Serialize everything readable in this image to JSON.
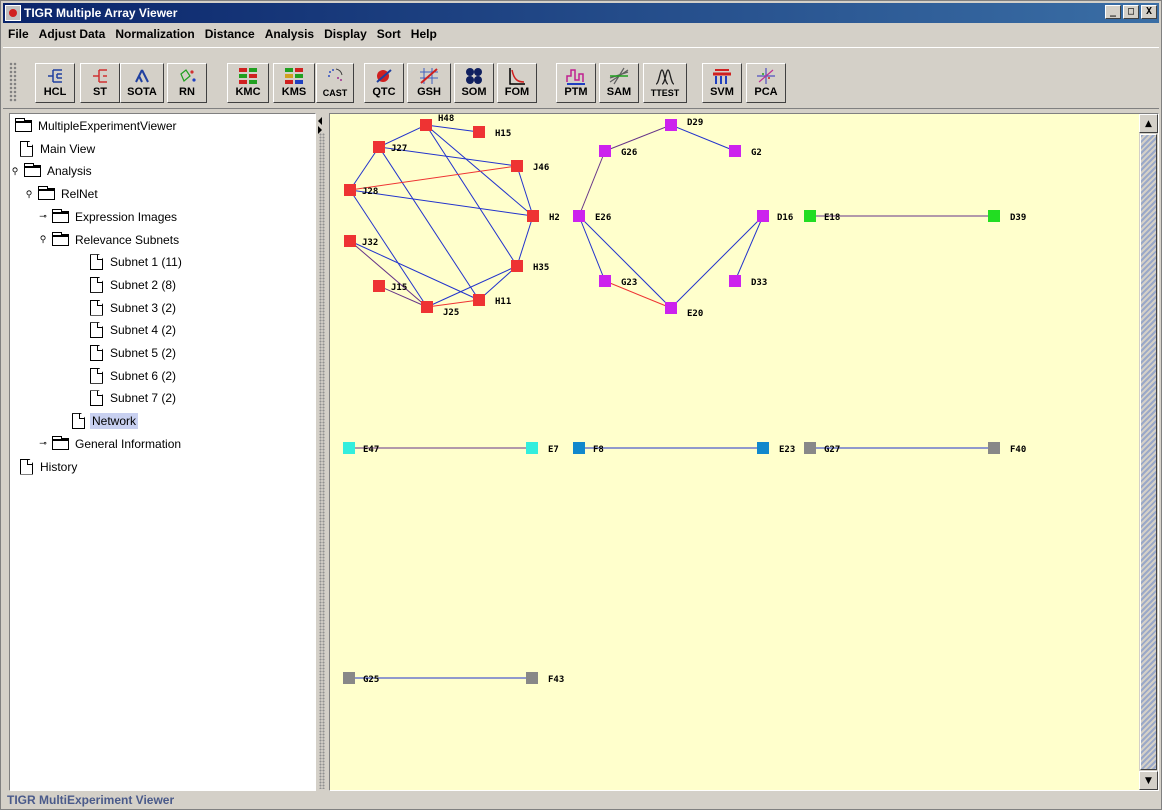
{
  "window": {
    "title": "TIGR Multiple Array Viewer",
    "min_label": "_",
    "max_label": "□",
    "close_label": "X"
  },
  "menu": [
    "File",
    "Adjust Data",
    "Normalization",
    "Distance",
    "Analysis",
    "Display",
    "Sort",
    "Help"
  ],
  "toolbar": [
    {
      "label": "HCL",
      "icon": "hcl-icon"
    },
    {
      "label": "ST",
      "icon": "st-icon"
    },
    {
      "label": "SOTA",
      "icon": "sota-icon"
    },
    {
      "label": "RN",
      "icon": "rn-icon"
    },
    {
      "label": "KMC",
      "icon": "kmc-icon"
    },
    {
      "label": "KMS",
      "icon": "kms-icon"
    },
    {
      "label": "CAST",
      "icon": "cast-icon"
    },
    {
      "label": "QTC",
      "icon": "qtc-icon"
    },
    {
      "label": "GSH",
      "icon": "gsh-icon"
    },
    {
      "label": "SOM",
      "icon": "som-icon"
    },
    {
      "label": "FOM",
      "icon": "fom-icon"
    },
    {
      "label": "PTM",
      "icon": "ptm-icon"
    },
    {
      "label": "SAM",
      "icon": "sam-icon"
    },
    {
      "label": "TTEST",
      "icon": "ttest-icon"
    },
    {
      "label": "SVM",
      "icon": "svm-icon"
    },
    {
      "label": "PCA",
      "icon": "pca-icon"
    }
  ],
  "tree": [
    {
      "label": "MultipleExperimentViewer",
      "icon": "folder",
      "toggle": ""
    },
    {
      "label": "Main View",
      "icon": "doc",
      "toggle": ""
    },
    {
      "label": "Analysis",
      "icon": "folder",
      "toggle": "open"
    },
    {
      "label": "RelNet",
      "icon": "folder",
      "toggle": "open"
    },
    {
      "label": "Expression Images",
      "icon": "folder",
      "toggle": "closed"
    },
    {
      "label": "Relevance Subnets",
      "icon": "folder",
      "toggle": "open"
    },
    {
      "label": "Subnet 1 (11)",
      "icon": "doc",
      "toggle": ""
    },
    {
      "label": "Subnet 2 (8)",
      "icon": "doc",
      "toggle": ""
    },
    {
      "label": "Subnet 3 (2)",
      "icon": "doc",
      "toggle": ""
    },
    {
      "label": "Subnet 4 (2)",
      "icon": "doc",
      "toggle": ""
    },
    {
      "label": "Subnet 5 (2)",
      "icon": "doc",
      "toggle": ""
    },
    {
      "label": "Subnet 6 (2)",
      "icon": "doc",
      "toggle": ""
    },
    {
      "label": "Subnet 7 (2)",
      "icon": "doc",
      "toggle": ""
    },
    {
      "label": "Network",
      "icon": "doc",
      "toggle": "",
      "selected": true
    },
    {
      "label": "General Information",
      "icon": "folder",
      "toggle": "closed"
    },
    {
      "label": "History",
      "icon": "doc",
      "toggle": ""
    }
  ],
  "network": {
    "nodes": [
      {
        "id": "H48",
        "color": "#ee3333"
      },
      {
        "id": "H15",
        "color": "#ee3333"
      },
      {
        "id": "J27",
        "color": "#ee3333"
      },
      {
        "id": "J46",
        "color": "#ee3333"
      },
      {
        "id": "J28",
        "color": "#ee3333"
      },
      {
        "id": "H2",
        "color": "#ee3333"
      },
      {
        "id": "J32",
        "color": "#ee3333"
      },
      {
        "id": "H35",
        "color": "#ee3333"
      },
      {
        "id": "J15",
        "color": "#ee3333"
      },
      {
        "id": "H11",
        "color": "#ee3333"
      },
      {
        "id": "J25",
        "color": "#ee3333"
      },
      {
        "id": "D29",
        "color": "#cc22ee"
      },
      {
        "id": "G26",
        "color": "#cc22ee"
      },
      {
        "id": "G2",
        "color": "#cc22ee"
      },
      {
        "id": "E26",
        "color": "#cc22ee"
      },
      {
        "id": "D16",
        "color": "#cc22ee"
      },
      {
        "id": "G23",
        "color": "#cc22ee"
      },
      {
        "id": "D33",
        "color": "#cc22ee"
      },
      {
        "id": "E20",
        "color": "#cc22ee"
      },
      {
        "id": "E18",
        "color": "#22dd22"
      },
      {
        "id": "D39",
        "color": "#22dd22"
      },
      {
        "id": "E47",
        "color": "#33eedd"
      },
      {
        "id": "E7",
        "color": "#33eedd"
      },
      {
        "id": "F8",
        "color": "#1188cc"
      },
      {
        "id": "E23",
        "color": "#1188cc"
      },
      {
        "id": "G27",
        "color": "#888888"
      },
      {
        "id": "F40",
        "color": "#888888"
      },
      {
        "id": "G25",
        "color": "#888888"
      },
      {
        "id": "F43",
        "color": "#888888"
      }
    ],
    "edges": [
      {
        "from": "H48",
        "to": "H15",
        "color": "#2233cc"
      },
      {
        "from": "H48",
        "to": "J27",
        "color": "#2233cc"
      },
      {
        "from": "H48",
        "to": "H2",
        "color": "#2233cc"
      },
      {
        "from": "H48",
        "to": "H35",
        "color": "#2233cc"
      },
      {
        "from": "J27",
        "to": "J46",
        "color": "#2233cc"
      },
      {
        "from": "J27",
        "to": "J28",
        "color": "#2233cc"
      },
      {
        "from": "J27",
        "to": "H11",
        "color": "#2233cc"
      },
      {
        "from": "J28",
        "to": "J46",
        "color": "#ee3333"
      },
      {
        "from": "J28",
        "to": "H2",
        "color": "#2233cc"
      },
      {
        "from": "J28",
        "to": "J25",
        "color": "#2233cc"
      },
      {
        "from": "J46",
        "to": "H2",
        "color": "#2233cc"
      },
      {
        "from": "H2",
        "to": "H35",
        "color": "#2233cc"
      },
      {
        "from": "J32",
        "to": "H11",
        "color": "#2233cc"
      },
      {
        "from": "J32",
        "to": "J25",
        "color": "#663388"
      },
      {
        "from": "J15",
        "to": "J25",
        "color": "#663388"
      },
      {
        "from": "J25",
        "to": "H11",
        "color": "#ee3333"
      },
      {
        "from": "J25",
        "to": "H35",
        "color": "#2233cc"
      },
      {
        "from": "H11",
        "to": "H35",
        "color": "#2233cc"
      },
      {
        "from": "D29",
        "to": "G26",
        "color": "#663388"
      },
      {
        "from": "D29",
        "to": "G2",
        "color": "#2233cc"
      },
      {
        "from": "G26",
        "to": "E26",
        "color": "#663388"
      },
      {
        "from": "E26",
        "to": "G23",
        "color": "#2233cc"
      },
      {
        "from": "E26",
        "to": "E20",
        "color": "#2233cc"
      },
      {
        "from": "G23",
        "to": "E20",
        "color": "#ee3333"
      },
      {
        "from": "E20",
        "to": "D16",
        "color": "#2233cc"
      },
      {
        "from": "D16",
        "to": "D33",
        "color": "#2233cc"
      },
      {
        "from": "E18",
        "to": "D39",
        "color": "#663388"
      },
      {
        "from": "E47",
        "to": "E7",
        "color": "#663388"
      },
      {
        "from": "F8",
        "to": "E23",
        "color": "#2233cc"
      },
      {
        "from": "G27",
        "to": "F40",
        "color": "#2233cc"
      },
      {
        "from": "G25",
        "to": "F43",
        "color": "#2233cc"
      }
    ]
  },
  "scrollbar": {
    "up_label": "▲",
    "down_label": "▼"
  },
  "status": "TIGR MultiExperiment Viewer"
}
